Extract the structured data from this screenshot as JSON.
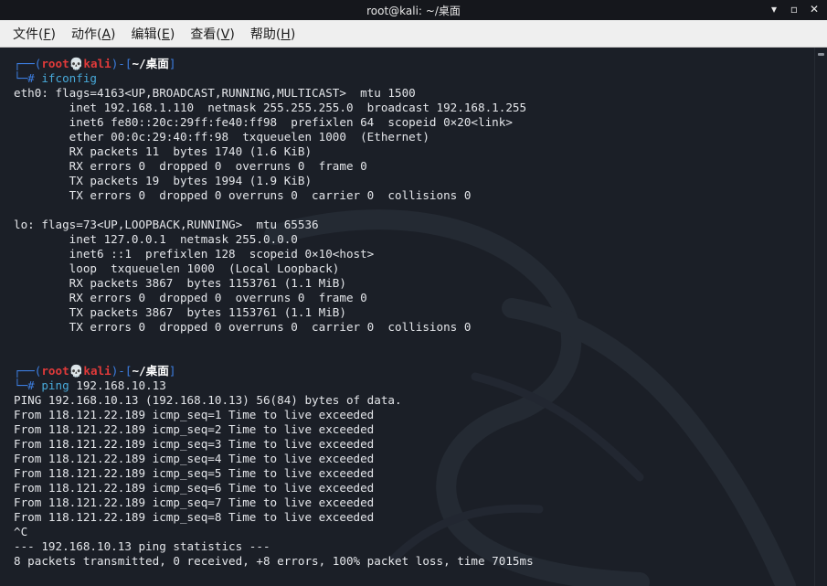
{
  "window": {
    "title": "root@kali: ~/桌面",
    "controls": {
      "minimize": "▾",
      "maximize": "▫",
      "close": "✕"
    }
  },
  "menu": [
    {
      "label": "文件(F)",
      "base": "文件(",
      "key": "F",
      "end": ")"
    },
    {
      "label": "动作(A)",
      "base": "动作(",
      "key": "A",
      "end": ")"
    },
    {
      "label": "编辑(E)",
      "base": "编辑(",
      "key": "E",
      "end": ")"
    },
    {
      "label": "查看(V)",
      "base": "查看(",
      "key": "V",
      "end": ")"
    },
    {
      "label": "帮助(H)",
      "base": "帮助(",
      "key": "H",
      "end": ")"
    }
  ],
  "prompt": {
    "open": "┌──(",
    "user": "root",
    "skull": "💀",
    "host": "kali",
    "mid": ")-[",
    "path": "~/桌面",
    "close": "]",
    "hash": "└─#"
  },
  "commands": [
    {
      "cmd": "ifconfig",
      "arg": "",
      "output": [
        "eth0: flags=4163<UP,BROADCAST,RUNNING,MULTICAST>  mtu 1500",
        "        inet 192.168.1.110  netmask 255.255.255.0  broadcast 192.168.1.255",
        "        inet6 fe80::20c:29ff:fe40:ff98  prefixlen 64  scopeid 0×20<link>",
        "        ether 00:0c:29:40:ff:98  txqueuelen 1000  (Ethernet)",
        "        RX packets 11  bytes 1740 (1.6 KiB)",
        "        RX errors 0  dropped 0  overruns 0  frame 0",
        "        TX packets 19  bytes 1994 (1.9 KiB)",
        "        TX errors 0  dropped 0 overruns 0  carrier 0  collisions 0",
        "",
        "lo: flags=73<UP,LOOPBACK,RUNNING>  mtu 65536",
        "        inet 127.0.0.1  netmask 255.0.0.0",
        "        inet6 ::1  prefixlen 128  scopeid 0×10<host>",
        "        loop  txqueuelen 1000  (Local Loopback)",
        "        RX packets 3867  bytes 1153761 (1.1 MiB)",
        "        RX errors 0  dropped 0  overruns 0  frame 0",
        "        TX packets 3867  bytes 1153761 (1.1 MiB)",
        "        TX errors 0  dropped 0 overruns 0  carrier 0  collisions 0",
        "",
        ""
      ]
    },
    {
      "cmd": "ping",
      "arg": " 192.168.10.13",
      "output": [
        "PING 192.168.10.13 (192.168.10.13) 56(84) bytes of data.",
        "From 118.121.22.189 icmp_seq=1 Time to live exceeded",
        "From 118.121.22.189 icmp_seq=2 Time to live exceeded",
        "From 118.121.22.189 icmp_seq=3 Time to live exceeded",
        "From 118.121.22.189 icmp_seq=4 Time to live exceeded",
        "From 118.121.22.189 icmp_seq=5 Time to live exceeded",
        "From 118.121.22.189 icmp_seq=6 Time to live exceeded",
        "From 118.121.22.189 icmp_seq=7 Time to live exceeded",
        "From 118.121.22.189 icmp_seq=8 Time to live exceeded",
        "^C",
        "--- 192.168.10.13 ping statistics ---",
        "8 packets transmitted, 0 received, +8 errors, 100% packet loss, time 7015ms"
      ]
    }
  ],
  "colors": {
    "background": "#1b1f27",
    "prompt_blue": "#3d7fe3",
    "prompt_red": "#e03a3a",
    "command": "#47a8d8",
    "text": "#e4e6ea"
  }
}
